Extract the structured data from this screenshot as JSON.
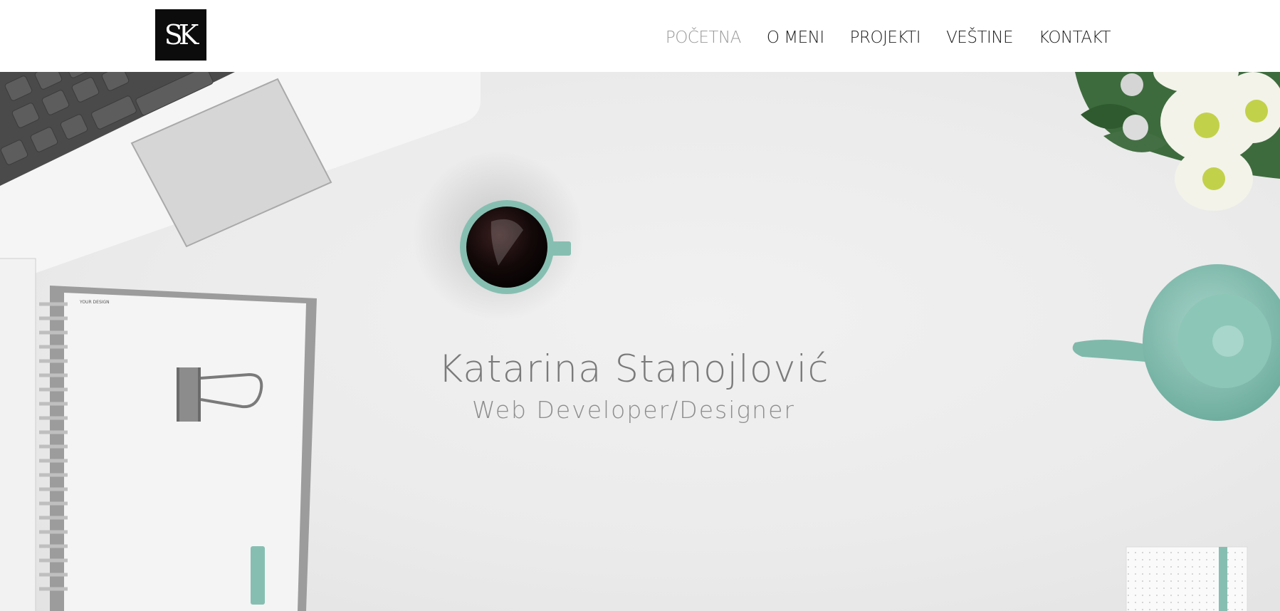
{
  "header": {
    "logo_text": "SK",
    "nav": [
      {
        "label": "POČETNA",
        "active": true
      },
      {
        "label": "O MENI",
        "active": false
      },
      {
        "label": "PROJEKTI",
        "active": false
      },
      {
        "label": "VEŠTINE",
        "active": false
      },
      {
        "label": "KONTAKT",
        "active": false
      }
    ]
  },
  "hero": {
    "name": "Katarina Stanojlović",
    "subtitle": "Web Developer/Designer",
    "notebook_label": "YOUR DESIGN"
  },
  "colors": {
    "nav_active": "#9a9a9a",
    "nav_default": "#1e1e1e",
    "accent_mint": "#86bfb1",
    "logo_bg": "#0c0c0c"
  }
}
